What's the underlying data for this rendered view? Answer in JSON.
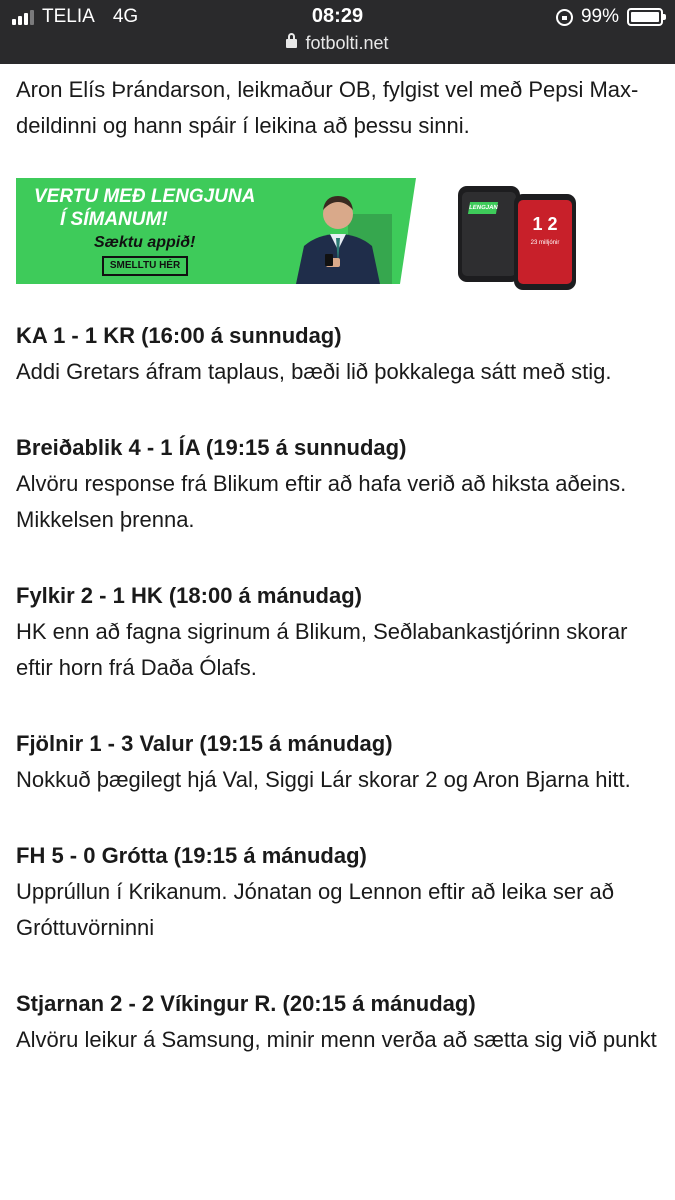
{
  "status_bar": {
    "carrier": "TELIA",
    "network": "4G",
    "time": "08:29",
    "url": "fotbolti.net",
    "battery_percent": "99%",
    "battery_level": 0.99
  },
  "article": {
    "intro": "Aron Elís Þrándarson, leikmaður OB, fylgist vel með Pepsi Max-deildinni og hann spáir í leikina að þessu sinni.",
    "banner": {
      "line1": "VERTU MEÐ LENGJUNA",
      "line2": "Í SÍMANUM!",
      "line3": "Sæktu appið!",
      "button": "SMELLTU HÉR",
      "phone1_logo": "LENGJAN",
      "phone2_number": "1 2",
      "phone2_sub": "23 milljónir",
      "green": "#3ecb5a",
      "red": "#c8202a"
    },
    "matches": [
      {
        "title": "KA 1 - 1 KR (16:00 á sunnudag)",
        "text": "Addi Gretars áfram taplaus, bæði lið þokkalega sátt með stig."
      },
      {
        "title": "Breiðablik 4 - 1 ÍA (19:15 á sunnudag)",
        "text": "Alvöru response frá Blikum eftir að hafa verið að hiksta aðeins. Mikkelsen þrenna."
      },
      {
        "title": "Fylkir 2 - 1 HK (18:00 á mánudag)",
        "text": "HK enn að fagna sigrinum á Blikum, Seðlabankastjórinn skorar eftir horn frá Daða Ólafs."
      },
      {
        "title": "Fjölnir 1 - 3 Valur (19:15 á mánudag)",
        "text": "Nokkuð þægilegt hjá Val, Siggi Lár skorar 2 og Aron Bjarna hitt."
      },
      {
        "title": "FH 5 - 0 Grótta (19:15 á mánudag)",
        "text": "Upprúllun í Krikanum. Jónatan og Lennon eftir að leika ser að Gróttuvörninni"
      },
      {
        "title": "Stjarnan 2 - 2 Víkingur R. (20:15 á mánudag)",
        "text": "Alvöru leikur á Samsung, minir menn verða að sætta sig við punkt"
      }
    ]
  }
}
